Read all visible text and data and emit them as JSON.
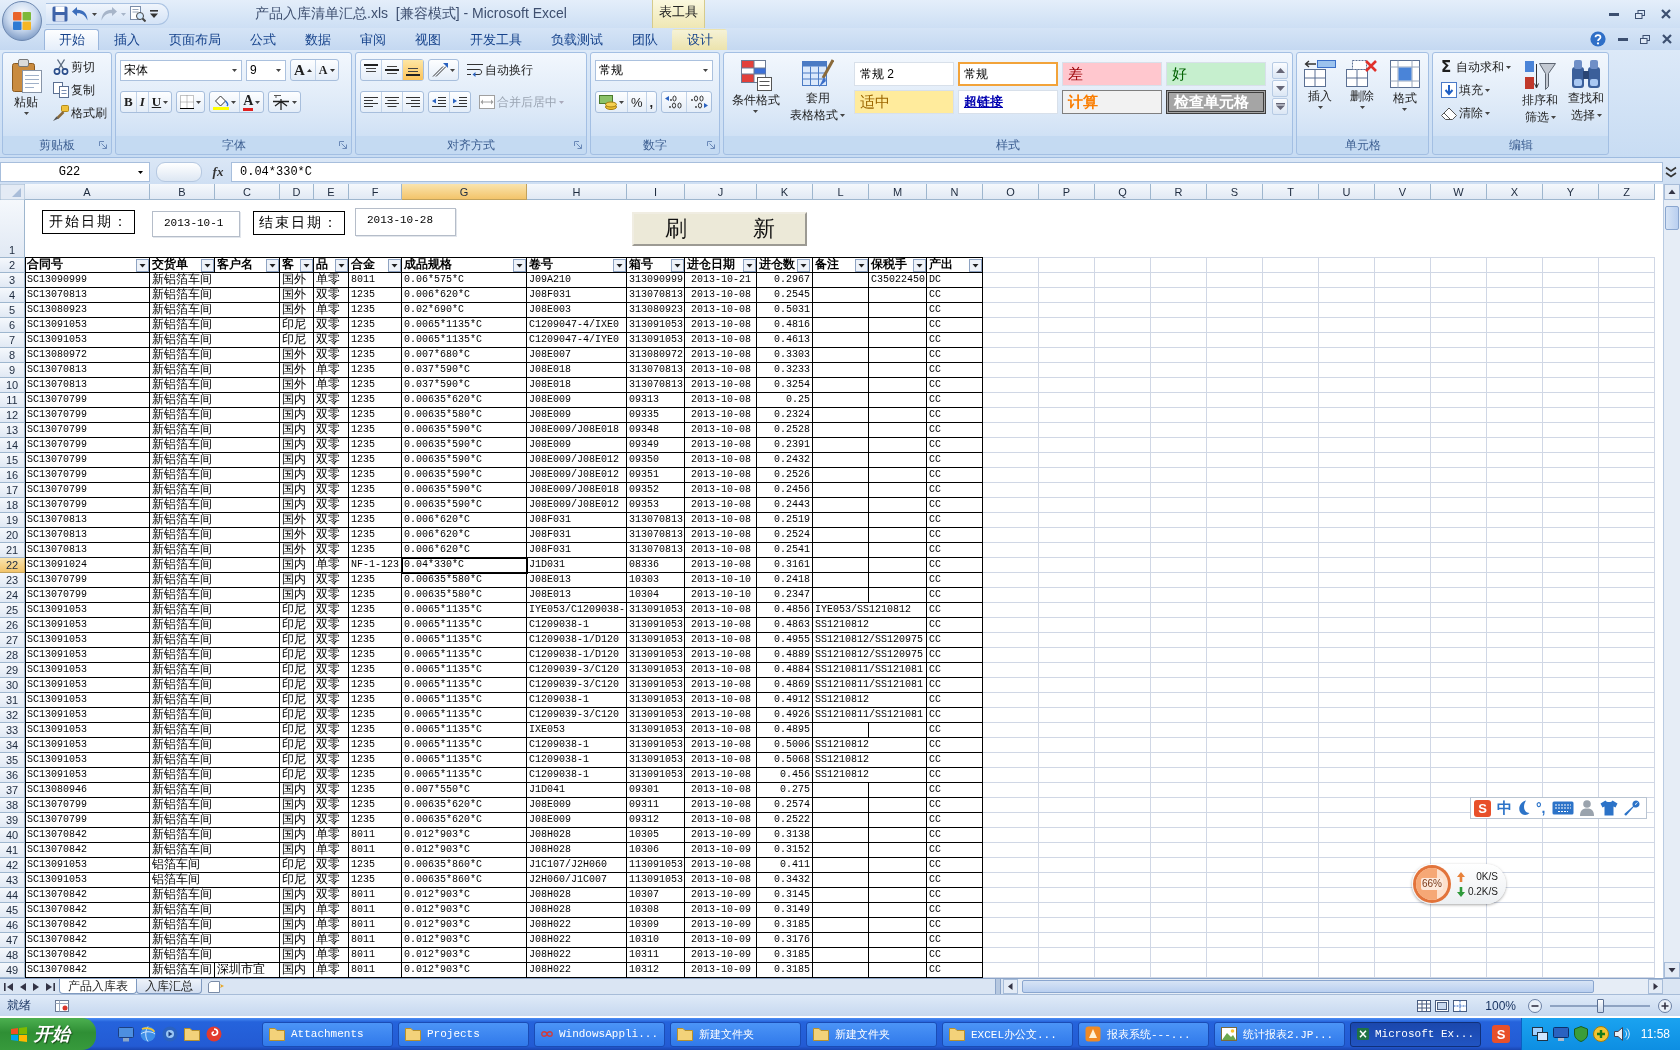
{
  "window": {
    "title": "产品入库清单汇总.xls  [兼容模式] - Microsoft Excel",
    "contextual_group": "表工具"
  },
  "quick_access_toolbar": {
    "redo": {
      "disabled": true
    }
  },
  "ribbon_tabs": [
    {
      "label": "开始",
      "selected": true,
      "contextual": false
    },
    {
      "label": "插入",
      "selected": false,
      "contextual": false
    },
    {
      "label": "页面布局",
      "selected": false,
      "contextual": false
    },
    {
      "label": "公式",
      "selected": false,
      "contextual": false
    },
    {
      "label": "数据",
      "selected": false,
      "contextual": false
    },
    {
      "label": "审阅",
      "selected": false,
      "contextual": false
    },
    {
      "label": "视图",
      "selected": false,
      "contextual": false
    },
    {
      "label": "开发工具",
      "selected": false,
      "contextual": false
    },
    {
      "label": "负载测试",
      "selected": false,
      "contextual": false
    },
    {
      "label": "团队",
      "selected": false,
      "contextual": false
    },
    {
      "label": "设计",
      "selected": false,
      "contextual": true
    }
  ],
  "ribbon": {
    "clipboard": {
      "title": "剪贴板",
      "paste": "粘贴",
      "cut": "剪切",
      "copy": "复制",
      "format_painter": "格式刷"
    },
    "font": {
      "title": "字体",
      "name": "宋体",
      "size": "9",
      "grow": "A",
      "shrink": "A",
      "bold": "B",
      "italic": "I",
      "underline": "U",
      "font_color": "A"
    },
    "alignment": {
      "title": "对齐方式",
      "vertical": [
        {
          "kind": "top",
          "selected": false
        },
        {
          "kind": "middle",
          "selected": false
        },
        {
          "kind": "bottom",
          "selected": true
        }
      ],
      "horizontal": [
        {
          "kind": "left",
          "selected": false
        },
        {
          "kind": "center",
          "selected": false
        },
        {
          "kind": "right",
          "selected": false
        }
      ],
      "wrap_text": "自动换行",
      "merge_center": {
        "label": "合并后居中",
        "disabled": true
      }
    },
    "number": {
      "title": "数字",
      "format": "常规",
      "percent": "%",
      "comma": ","
    },
    "styles": {
      "title": "样式",
      "conditional_formatting": "条件格式",
      "table_format": [
        "套用",
        "表格格式"
      ],
      "gallery": [
        {
          "label": "常规 2",
          "kind": "normal2",
          "selected": false
        },
        {
          "label": "常规",
          "kind": "normal",
          "selected": true
        },
        {
          "label": "差",
          "kind": "bad",
          "selected": false
        },
        {
          "label": "好",
          "kind": "good",
          "selected": false
        },
        {
          "label": "适中",
          "kind": "neutral",
          "selected": false
        },
        {
          "label": "超链接",
          "kind": "hyperlink",
          "selected": false
        },
        {
          "label": "计算",
          "kind": "calculation",
          "selected": false
        },
        {
          "label": "检查单元格",
          "kind": "check",
          "selected": false
        }
      ]
    },
    "cells": {
      "title": "单元格",
      "buttons": [
        {
          "label": "插入",
          "kind": "insert"
        },
        {
          "label": "删除",
          "kind": "delete"
        },
        {
          "label": "格式",
          "kind": "format"
        }
      ]
    },
    "editing": {
      "title": "编辑",
      "autosum": {
        "symbol": "Σ",
        "label": "自动求和"
      },
      "fill": "填充",
      "clear": "清除",
      "sort_filter": [
        "排序和",
        "筛选"
      ],
      "find_select": [
        "查找和",
        "选择"
      ]
    }
  },
  "formula_bar": {
    "name_box": "G22",
    "function_symbol": "fx",
    "formula": "0.04*330*C"
  },
  "sheet": {
    "columns": [
      {
        "letter": "A",
        "selected": false
      },
      {
        "letter": "B",
        "selected": false
      },
      {
        "letter": "C",
        "selected": false
      },
      {
        "letter": "D",
        "selected": false
      },
      {
        "letter": "E",
        "selected": false
      },
      {
        "letter": "F",
        "selected": false
      },
      {
        "letter": "G",
        "selected": true
      },
      {
        "letter": "H",
        "selected": false
      },
      {
        "letter": "I",
        "selected": false
      },
      {
        "letter": "J",
        "selected": false
      },
      {
        "letter": "K",
        "selected": false
      },
      {
        "letter": "L",
        "selected": false
      },
      {
        "letter": "M",
        "selected": false
      },
      {
        "letter": "N",
        "selected": false
      },
      {
        "letter": "O",
        "selected": false
      },
      {
        "letter": "P",
        "selected": false
      },
      {
        "letter": "Q",
        "selected": false
      },
      {
        "letter": "R",
        "selected": false
      },
      {
        "letter": "S",
        "selected": false
      },
      {
        "letter": "T",
        "selected": false
      },
      {
        "letter": "U",
        "selected": false
      },
      {
        "letter": "V",
        "selected": false
      },
      {
        "letter": "W",
        "selected": false
      },
      {
        "letter": "X",
        "selected": false
      },
      {
        "letter": "Y",
        "selected": false
      },
      {
        "letter": "Z",
        "selected": false
      }
    ],
    "filter_form": {
      "start_label": "开始日期：",
      "start_value": "2013-10-1",
      "end_label": "结束日期：",
      "end_value": "2013-10-28",
      "refresh_button": "刷　　　新"
    },
    "row_1": {
      "number": "1",
      "selected": false
    },
    "header_row": {
      "number": "2",
      "selected": false,
      "cells": {
        "A": "合同号",
        "B": "交货单",
        "C": "客户名",
        "D": "客",
        "E": "品",
        "F": "合金",
        "G": "成品规格",
        "H": "卷号",
        "I": "箱号",
        "J": "进仓日期",
        "K": "进仓数",
        "L": "备注",
        "M": "保税手",
        "N": "产出"
      }
    },
    "rows": [
      {
        "number": "3",
        "selected": false,
        "cells": {
          "A": "SC13090999",
          "B": "新铝箔车间",
          "D": "国外",
          "E": "单零",
          "F": "8011",
          "G": "0.06*575*C",
          "H": "J09A210",
          "I": "313090999",
          "J": "2013-10-21",
          "K": "0.2967",
          "M": "C35022450",
          "N": "DC"
        }
      },
      {
        "number": "4",
        "selected": false,
        "cells": {
          "A": "SC13070813",
          "B": "新铝箔车间",
          "D": "国外",
          "E": "双零",
          "F": "1235",
          "G": "0.006*620*C",
          "H": "J08F031",
          "I": "313070813",
          "J": "2013-10-08",
          "K": "0.2545",
          "N": "CC"
        }
      },
      {
        "number": "5",
        "selected": false,
        "cells": {
          "A": "SC13080923",
          "B": "新铝箔车间",
          "D": "国外",
          "E": "单零",
          "F": "1235",
          "G": "0.02*690*C",
          "H": "J08E003",
          "I": "313080923",
          "J": "2013-10-08",
          "K": "0.5031",
          "N": "CC"
        }
      },
      {
        "number": "6",
        "selected": false,
        "cells": {
          "A": "SC13091053",
          "B": "新铝箔车间",
          "D": "印尼",
          "E": "双零",
          "F": "1235",
          "G": "0.0065*1135*C",
          "H": "C1209047-4/IXE0",
          "I": "313091053",
          "J": "2013-10-08",
          "K": "0.4816",
          "N": "CC"
        }
      },
      {
        "number": "7",
        "selected": false,
        "cells": {
          "A": "SC13091053",
          "B": "新铝箔车间",
          "D": "印尼",
          "E": "双零",
          "F": "1235",
          "G": "0.0065*1135*C",
          "H": "C1209047-4/IYE0",
          "I": "313091053",
          "J": "2013-10-08",
          "K": "0.4613",
          "N": "CC"
        }
      },
      {
        "number": "8",
        "selected": false,
        "cells": {
          "A": "SC13080972",
          "B": "新铝箔车间",
          "D": "国外",
          "E": "双零",
          "F": "1235",
          "G": "0.007*680*C",
          "H": "J08E007",
          "I": "313080972",
          "J": "2013-10-08",
          "K": "0.3303",
          "N": "CC"
        }
      },
      {
        "number": "9",
        "selected": false,
        "cells": {
          "A": "SC13070813",
          "B": "新铝箔车间",
          "D": "国外",
          "E": "单零",
          "F": "1235",
          "G": "0.037*590*C",
          "H": "J08E018",
          "I": "313070813",
          "J": "2013-10-08",
          "K": "0.3233",
          "N": "CC"
        }
      },
      {
        "number": "10",
        "selected": false,
        "cells": {
          "A": "SC13070813",
          "B": "新铝箔车间",
          "D": "国外",
          "E": "单零",
          "F": "1235",
          "G": "0.037*590*C",
          "H": "J08E018",
          "I": "313070813",
          "J": "2013-10-08",
          "K": "0.3254",
          "N": "CC"
        }
      },
      {
        "number": "11",
        "selected": false,
        "cells": {
          "A": "SC13070799",
          "B": "新铝箔车间",
          "D": "国内",
          "E": "双零",
          "F": "1235",
          "G": "0.00635*620*C",
          "H": "J08E009",
          "I": "09313",
          "J": "2013-10-08",
          "K": "0.25",
          "N": "CC"
        }
      },
      {
        "number": "12",
        "selected": false,
        "cells": {
          "A": "SC13070799",
          "B": "新铝箔车间",
          "D": "国内",
          "E": "双零",
          "F": "1235",
          "G": "0.00635*580*C",
          "H": "J08E009",
          "I": "09335",
          "J": "2013-10-08",
          "K": "0.2324",
          "N": "CC"
        }
      },
      {
        "number": "13",
        "selected": false,
        "cells": {
          "A": "SC13070799",
          "B": "新铝箔车间",
          "D": "国内",
          "E": "双零",
          "F": "1235",
          "G": "0.00635*590*C",
          "H": "J08E009/J08E018",
          "I": "09348",
          "J": "2013-10-08",
          "K": "0.2528",
          "N": "CC"
        }
      },
      {
        "number": "14",
        "selected": false,
        "cells": {
          "A": "SC13070799",
          "B": "新铝箔车间",
          "D": "国内",
          "E": "双零",
          "F": "1235",
          "G": "0.00635*590*C",
          "H": "J08E009",
          "I": "09349",
          "J": "2013-10-08",
          "K": "0.2391",
          "N": "CC"
        }
      },
      {
        "number": "15",
        "selected": false,
        "cells": {
          "A": "SC13070799",
          "B": "新铝箔车间",
          "D": "国内",
          "E": "双零",
          "F": "1235",
          "G": "0.00635*590*C",
          "H": "J08E009/J08E012",
          "I": "09350",
          "J": "2013-10-08",
          "K": "0.2432",
          "N": "CC"
        }
      },
      {
        "number": "16",
        "selected": false,
        "cells": {
          "A": "SC13070799",
          "B": "新铝箔车间",
          "D": "国内",
          "E": "双零",
          "F": "1235",
          "G": "0.00635*590*C",
          "H": "J08E009/J08E012",
          "I": "09351",
          "J": "2013-10-08",
          "K": "0.2526",
          "N": "CC"
        }
      },
      {
        "number": "17",
        "selected": false,
        "cells": {
          "A": "SC13070799",
          "B": "新铝箔车间",
          "D": "国内",
          "E": "双零",
          "F": "1235",
          "G": "0.00635*590*C",
          "H": "J08E009/J08E018",
          "I": "09352",
          "J": "2013-10-08",
          "K": "0.2456",
          "N": "CC"
        }
      },
      {
        "number": "18",
        "selected": false,
        "cells": {
          "A": "SC13070799",
          "B": "新铝箔车间",
          "D": "国内",
          "E": "双零",
          "F": "1235",
          "G": "0.00635*590*C",
          "H": "J08E009/J08E012",
          "I": "09353",
          "J": "2013-10-08",
          "K": "0.2443",
          "N": "CC"
        }
      },
      {
        "number": "19",
        "selected": false,
        "cells": {
          "A": "SC13070813",
          "B": "新铝箔车间",
          "D": "国外",
          "E": "双零",
          "F": "1235",
          "G": "0.006*620*C",
          "H": "J08F031",
          "I": "313070813",
          "J": "2013-10-08",
          "K": "0.2519",
          "N": "CC"
        }
      },
      {
        "number": "20",
        "selected": false,
        "cells": {
          "A": "SC13070813",
          "B": "新铝箔车间",
          "D": "国外",
          "E": "双零",
          "F": "1235",
          "G": "0.006*620*C",
          "H": "J08F031",
          "I": "313070813",
          "J": "2013-10-08",
          "K": "0.2524",
          "N": "CC"
        }
      },
      {
        "number": "21",
        "selected": false,
        "cells": {
          "A": "SC13070813",
          "B": "新铝箔车间",
          "D": "国外",
          "E": "双零",
          "F": "1235",
          "G": "0.006*620*C",
          "H": "J08F031",
          "I": "313070813",
          "J": "2013-10-08",
          "K": "0.2541",
          "N": "CC"
        }
      },
      {
        "number": "22",
        "selected": true,
        "cells": {
          "A": "SC13091024",
          "B": "新铝箔车间",
          "D": "国内",
          "E": "单零",
          "F": "NF-1-123",
          "G": "0.04*330*C",
          "H": "J1D031",
          "I": "08336",
          "J": "2013-10-08",
          "K": "0.3161",
          "N": "CC"
        }
      },
      {
        "number": "23",
        "selected": false,
        "cells": {
          "A": "SC13070799",
          "B": "新铝箔车间",
          "D": "国内",
          "E": "双零",
          "F": "1235",
          "G": "0.00635*580*C",
          "H": "J08E013",
          "I": "10303",
          "J": "2013-10-10",
          "K": "0.2418",
          "N": "CC"
        }
      },
      {
        "number": "24",
        "selected": false,
        "cells": {
          "A": "SC13070799",
          "B": "新铝箔车间",
          "D": "国内",
          "E": "双零",
          "F": "1235",
          "G": "0.00635*580*C",
          "H": "J08E013",
          "I": "10304",
          "J": "2013-10-10",
          "K": "0.2347",
          "N": "CC"
        }
      },
      {
        "number": "25",
        "selected": false,
        "cells": {
          "A": "SC13091053",
          "B": "新铝箔车间",
          "D": "印尼",
          "E": "双零",
          "F": "1235",
          "G": "0.0065*1135*C",
          "H": "IYE053/C1209038-",
          "I": "313091053",
          "J": "2013-10-08",
          "K": "0.4856",
          "L": "IYE053/SS1210812",
          "N": "CC"
        }
      },
      {
        "number": "26",
        "selected": false,
        "cells": {
          "A": "SC13091053",
          "B": "新铝箔车间",
          "D": "印尼",
          "E": "双零",
          "F": "1235",
          "G": "0.0065*1135*C",
          "H": "C1209038-1",
          "I": "313091053",
          "J": "2013-10-08",
          "K": "0.4863",
          "L": "SS1210812",
          "N": "CC"
        }
      },
      {
        "number": "27",
        "selected": false,
        "cells": {
          "A": "SC13091053",
          "B": "新铝箔车间",
          "D": "印尼",
          "E": "双零",
          "F": "1235",
          "G": "0.0065*1135*C",
          "H": "C1209038-1/D120",
          "I": "313091053",
          "J": "2013-10-08",
          "K": "0.4955",
          "L": "SS1210812/SS120975",
          "N": "CC"
        }
      },
      {
        "number": "28",
        "selected": false,
        "cells": {
          "A": "SC13091053",
          "B": "新铝箔车间",
          "D": "印尼",
          "E": "双零",
          "F": "1235",
          "G": "0.0065*1135*C",
          "H": "C1209038-1/D120",
          "I": "313091053",
          "J": "2013-10-08",
          "K": "0.4889",
          "L": "SS1210812/SS120975",
          "N": "CC"
        }
      },
      {
        "number": "29",
        "selected": false,
        "cells": {
          "A": "SC13091053",
          "B": "新铝箔车间",
          "D": "印尼",
          "E": "双零",
          "F": "1235",
          "G": "0.0065*1135*C",
          "H": "C1209039-3/C120",
          "I": "313091053",
          "J": "2013-10-08",
          "K": "0.4884",
          "L": "SS1210811/SS121081",
          "N": "CC"
        }
      },
      {
        "number": "30",
        "selected": false,
        "cells": {
          "A": "SC13091053",
          "B": "新铝箔车间",
          "D": "印尼",
          "E": "双零",
          "F": "1235",
          "G": "0.0065*1135*C",
          "H": "C1209039-3/C120",
          "I": "313091053",
          "J": "2013-10-08",
          "K": "0.4869",
          "L": "SS1210811/SS121081",
          "N": "CC"
        }
      },
      {
        "number": "31",
        "selected": false,
        "cells": {
          "A": "SC13091053",
          "B": "新铝箔车间",
          "D": "印尼",
          "E": "双零",
          "F": "1235",
          "G": "0.0065*1135*C",
          "H": "C1209038-1",
          "I": "313091053",
          "J": "2013-10-08",
          "K": "0.4912",
          "L": "SS1210812",
          "N": "CC"
        }
      },
      {
        "number": "32",
        "selected": false,
        "cells": {
          "A": "SC13091053",
          "B": "新铝箔车间",
          "D": "印尼",
          "E": "双零",
          "F": "1235",
          "G": "0.0065*1135*C",
          "H": "C1209039-3/C120",
          "I": "313091053",
          "J": "2013-10-08",
          "K": "0.4926",
          "L": "SS1210811/SS121081",
          "N": "CC"
        }
      },
      {
        "number": "33",
        "selected": false,
        "cells": {
          "A": "SC13091053",
          "B": "新铝箔车间",
          "D": "印尼",
          "E": "双零",
          "F": "1235",
          "G": "0.0065*1135*C",
          "H": "IXE053",
          "I": "313091053",
          "J": "2013-10-08",
          "K": "0.4895",
          "N": "CC"
        }
      },
      {
        "number": "34",
        "selected": false,
        "cells": {
          "A": "SC13091053",
          "B": "新铝箔车间",
          "D": "印尼",
          "E": "双零",
          "F": "1235",
          "G": "0.0065*1135*C",
          "H": "C1209038-1",
          "I": "313091053",
          "J": "2013-10-08",
          "K": "0.5006",
          "L": "SS1210812",
          "N": "CC"
        }
      },
      {
        "number": "35",
        "selected": false,
        "cells": {
          "A": "SC13091053",
          "B": "新铝箔车间",
          "D": "印尼",
          "E": "双零",
          "F": "1235",
          "G": "0.0065*1135*C",
          "H": "C1209038-1",
          "I": "313091053",
          "J": "2013-10-08",
          "K": "0.5068",
          "L": "SS1210812",
          "N": "CC"
        }
      },
      {
        "number": "36",
        "selected": false,
        "cells": {
          "A": "SC13091053",
          "B": "新铝箔车间",
          "D": "印尼",
          "E": "双零",
          "F": "1235",
          "G": "0.0065*1135*C",
          "H": "C1209038-1",
          "I": "313091053",
          "J": "2013-10-08",
          "K": "0.456",
          "L": "SS1210812",
          "N": "CC"
        }
      },
      {
        "number": "37",
        "selected": false,
        "cells": {
          "A": "SC13080946",
          "B": "新铝箔车间",
          "D": "国内",
          "E": "双零",
          "F": "1235",
          "G": "0.007*550*C",
          "H": "J1D041",
          "I": "09301",
          "J": "2013-10-08",
          "K": "0.275",
          "N": "CC"
        }
      },
      {
        "number": "38",
        "selected": false,
        "cells": {
          "A": "SC13070799",
          "B": "新铝箔车间",
          "D": "国内",
          "E": "双零",
          "F": "1235",
          "G": "0.00635*620*C",
          "H": "J08E009",
          "I": "09311",
          "J": "2013-10-08",
          "K": "0.2574",
          "N": "CC"
        }
      },
      {
        "number": "39",
        "selected": false,
        "cells": {
          "A": "SC13070799",
          "B": "新铝箔车间",
          "D": "国内",
          "E": "双零",
          "F": "1235",
          "G": "0.00635*620*C",
          "H": "J08E009",
          "I": "09312",
          "J": "2013-10-08",
          "K": "0.2522",
          "N": "CC"
        }
      },
      {
        "number": "40",
        "selected": false,
        "cells": {
          "A": "SC13070842",
          "B": "新铝箔车间",
          "D": "国内",
          "E": "单零",
          "F": "8011",
          "G": "0.012*903*C",
          "H": "J08H028",
          "I": "10305",
          "J": "2013-10-09",
          "K": "0.3138",
          "N": "CC"
        }
      },
      {
        "number": "41",
        "selected": false,
        "cells": {
          "A": "SC13070842",
          "B": "新铝箔车间",
          "D": "国内",
          "E": "单零",
          "F": "8011",
          "G": "0.012*903*C",
          "H": "J08H028",
          "I": "10306",
          "J": "2013-10-09",
          "K": "0.3152",
          "N": "CC"
        }
      },
      {
        "number": "42",
        "selected": false,
        "cells": {
          "A": "SC13091053",
          "B": "铝箔车间",
          "D": "印尼",
          "E": "双零",
          "F": "1235",
          "G": "0.00635*860*C",
          "H": "J1C107/J2H060",
          "I": "113091053",
          "J": "2013-10-08",
          "K": "0.411",
          "N": "CC"
        }
      },
      {
        "number": "43",
        "selected": false,
        "cells": {
          "A": "SC13091053",
          "B": "铝箔车间",
          "D": "印尼",
          "E": "双零",
          "F": "1235",
          "G": "0.00635*860*C",
          "H": "J2H060/J1C007",
          "I": "113091053",
          "J": "2013-10-08",
          "K": "0.3432",
          "N": "CC"
        }
      },
      {
        "number": "44",
        "selected": false,
        "cells": {
          "A": "SC13070842",
          "B": "新铝箔车间",
          "D": "国内",
          "E": "双零",
          "F": "8011",
          "G": "0.012*903*C",
          "H": "J08H028",
          "I": "10307",
          "J": "2013-10-09",
          "K": "0.3145",
          "N": "CC"
        }
      },
      {
        "number": "45",
        "selected": false,
        "cells": {
          "A": "SC13070842",
          "B": "新铝箔车间",
          "D": "国内",
          "E": "单零",
          "F": "8011",
          "G": "0.012*903*C",
          "H": "J08H028",
          "I": "10308",
          "J": "2013-10-09",
          "K": "0.3149",
          "N": "CC"
        }
      },
      {
        "number": "46",
        "selected": false,
        "cells": {
          "A": "SC13070842",
          "B": "新铝箔车间",
          "D": "国内",
          "E": "单零",
          "F": "8011",
          "G": "0.012*903*C",
          "H": "J08H022",
          "I": "10309",
          "J": "2013-10-09",
          "K": "0.3185",
          "N": "CC"
        }
      },
      {
        "number": "47",
        "selected": false,
        "cells": {
          "A": "SC13070842",
          "B": "新铝箔车间",
          "D": "国内",
          "E": "单零",
          "F": "8011",
          "G": "0.012*903*C",
          "H": "J08H022",
          "I": "10310",
          "J": "2013-10-09",
          "K": "0.3176",
          "N": "CC"
        }
      },
      {
        "number": "48",
        "selected": false,
        "cells": {
          "A": "SC13070842",
          "B": "新铝箔车间",
          "D": "国内",
          "E": "单零",
          "F": "8011",
          "G": "0.012*903*C",
          "H": "J08H022",
          "I": "10311",
          "J": "2013-10-09",
          "K": "0.3185",
          "N": "CC"
        }
      },
      {
        "number": "49",
        "selected": false,
        "cells": {
          "A": "SC13070842",
          "B": "新铝箔车间",
          "C": "深圳市宜",
          "D": "国内",
          "E": "单零",
          "F": "8011",
          "G": "0.012*903*C",
          "H": "J08H022",
          "I": "10312",
          "J": "2013-10-09",
          "K": "0.3185",
          "N": "CC"
        }
      }
    ]
  },
  "sheet_tabs": [
    {
      "label": "产品入库表",
      "selected": true
    },
    {
      "label": "入库汇总",
      "selected": false
    }
  ],
  "status_bar": {
    "text": "就绪",
    "zoom": "100%",
    "zoom_slider": {
      "level": 0.5
    }
  },
  "taskbar": {
    "start": "开始",
    "tasks": [
      {
        "label": "Attachments",
        "kind": "folder",
        "selected": false
      },
      {
        "label": "Projects",
        "kind": "folder",
        "selected": false
      },
      {
        "label": "WindowsAppli...",
        "kind": "loop",
        "selected": false
      },
      {
        "label": "新建文件夹",
        "kind": "folder",
        "selected": false
      },
      {
        "label": "新建文件夹",
        "kind": "folder",
        "selected": false
      },
      {
        "label": "EXCEL办公文...",
        "kind": "folder",
        "selected": false
      },
      {
        "label": "报表系统---...",
        "kind": "app",
        "selected": false
      },
      {
        "label": "统计报表2.JP...",
        "kind": "image",
        "selected": false
      },
      {
        "label": "Microsoft Ex...",
        "kind": "excel",
        "selected": true
      }
    ],
    "tray": {
      "logo_letter": "S",
      "clock": "11:58"
    }
  },
  "ime_toolbar": {
    "logo_letter": "S",
    "mode": "中",
    "punctuation": "°,"
  },
  "net_monitor": {
    "level": 0.66,
    "percent": "66%",
    "upload": "0K/S",
    "download": "0.2K/S"
  }
}
